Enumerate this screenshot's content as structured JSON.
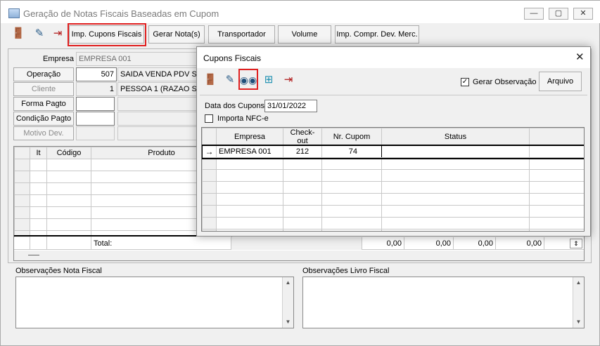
{
  "window": {
    "title": "Geração de Notas Fiscais Baseadas em Cupom",
    "min_label": "—",
    "max_label": "▢",
    "close_label": "✕"
  },
  "toolbar": {
    "buttons": [
      {
        "label": "Imp. Cupons Fiscais"
      },
      {
        "label": "Gerar Nota(s)"
      },
      {
        "label": "Transportador"
      },
      {
        "label": "Volume"
      },
      {
        "label": "Imp. Compr. Dev. Merc."
      }
    ]
  },
  "form": {
    "empresa_label": "Empresa",
    "empresa_value": "EMPRESA 001",
    "operacao_label": "Operação",
    "operacao_code": "507",
    "operacao_desc": "SAIDA VENDA PDV SA",
    "cliente_label": "Cliente",
    "cliente_code": "1",
    "cliente_desc": "PESSOA 1 (RAZAO SO",
    "forma_pagto_label": "Forma Pagto",
    "condicao_pagto_label": "Condição Pagto",
    "motivo_dev_label": "Motivo Dev."
  },
  "items_grid": {
    "columns": [
      "It",
      "Código",
      "Produto"
    ],
    "total_label": "Total:",
    "totals": [
      "0,00",
      "0,00",
      "0,00",
      "0,00"
    ]
  },
  "obs": {
    "nota_label": "Observações Nota Fiscal",
    "livro_label": "Observações Livro Fiscal"
  },
  "dialog": {
    "title": "Cupons Fiscais",
    "gerar_obs_label": "Gerar Observação",
    "gerar_obs_checked": true,
    "arquivo_label": "Arquivo",
    "data_label": "Data dos Cupons",
    "data_value": "31/01/2022",
    "importa_label": "Importa NFC-e",
    "importa_checked": false,
    "grid": {
      "columns": [
        "Empresa",
        "Check-out",
        "Nr. Cupom",
        "Status"
      ],
      "rows": [
        {
          "empresa": "EMPRESA 001",
          "checkout": "212",
          "cupom": "74",
          "status": ""
        }
      ]
    }
  }
}
